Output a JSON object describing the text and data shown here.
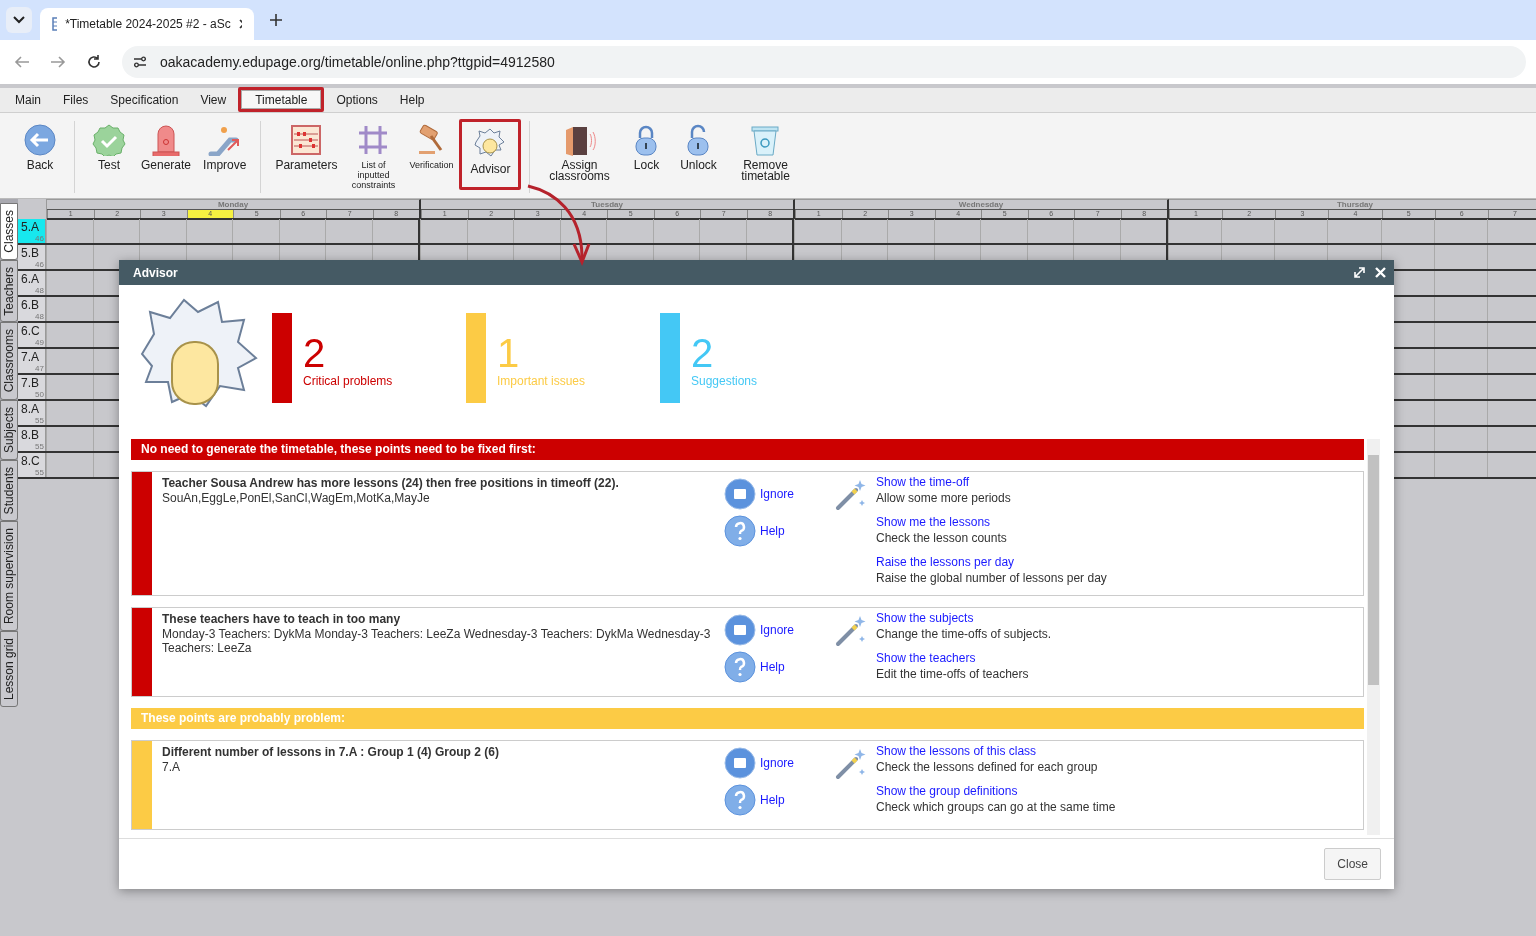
{
  "browser": {
    "tab_title": "*Timetable 2024-2025 #2 - aSc",
    "url": "oakacademy.edupage.org/timetable/online.php?ttgpid=4912580"
  },
  "menu": [
    {
      "label": "Main",
      "selected": false,
      "highlighted": false
    },
    {
      "label": "Files",
      "selected": false,
      "highlighted": false
    },
    {
      "label": "Specification",
      "selected": false,
      "highlighted": false
    },
    {
      "label": "View",
      "selected": false,
      "highlighted": false
    },
    {
      "label": "Timetable",
      "selected": true,
      "highlighted": true
    },
    {
      "label": "Options",
      "selected": false,
      "highlighted": false
    },
    {
      "label": "Help",
      "selected": false,
      "highlighted": false
    }
  ],
  "toolbar_groups": [
    {
      "buttons": [
        {
          "label": "Back",
          "kind": "back",
          "highlighted": false
        }
      ]
    },
    {
      "buttons": [
        {
          "label": "Test",
          "kind": "test",
          "highlighted": false
        },
        {
          "label": "Generate",
          "kind": "generate",
          "highlighted": false
        },
        {
          "label": "Improve",
          "kind": "improve",
          "highlighted": false
        }
      ]
    },
    {
      "buttons": [
        {
          "label": "Parameters",
          "kind": "parameters",
          "highlighted": false
        },
        {
          "label": "List of inputted constraints",
          "kind": "constraints",
          "highlighted": false
        },
        {
          "label": "Verification",
          "kind": "verification",
          "highlighted": false
        },
        {
          "label": "Advisor",
          "kind": "advisor",
          "highlighted": true
        }
      ]
    },
    {
      "buttons": [
        {
          "label": "Assign classrooms",
          "kind": "assign",
          "highlighted": false
        },
        {
          "label": "Lock",
          "kind": "lock",
          "highlighted": false
        },
        {
          "label": "Unlock",
          "kind": "unlock",
          "highlighted": false
        },
        {
          "label": "Remove timetable",
          "kind": "remove",
          "highlighted": false
        }
      ]
    }
  ],
  "side_tabs": [
    {
      "label": "Classes",
      "selected": true
    },
    {
      "label": "Teachers",
      "selected": false
    },
    {
      "label": "Classrooms",
      "selected": false
    },
    {
      "label": "Subjects",
      "selected": false
    },
    {
      "label": "Students",
      "selected": false
    },
    {
      "label": "Room supervision",
      "selected": false
    },
    {
      "label": "Lesson grid",
      "selected": false
    }
  ],
  "timetable": {
    "days": [
      {
        "name": "Monday",
        "periods": [
          {
            "label": "1",
            "selected": false
          },
          {
            "label": "2",
            "selected": false
          },
          {
            "label": "3",
            "selected": false
          },
          {
            "label": "4",
            "selected": true
          },
          {
            "label": "5",
            "selected": false
          },
          {
            "label": "6",
            "selected": false
          },
          {
            "label": "7",
            "selected": false
          },
          {
            "label": "8",
            "selected": false
          }
        ]
      },
      {
        "name": "Tuesday",
        "periods": [
          {
            "label": "1",
            "selected": false
          },
          {
            "label": "2",
            "selected": false
          },
          {
            "label": "3",
            "selected": false
          },
          {
            "label": "4",
            "selected": false
          },
          {
            "label": "5",
            "selected": false
          },
          {
            "label": "6",
            "selected": false
          },
          {
            "label": "7",
            "selected": false
          },
          {
            "label": "8",
            "selected": false
          }
        ]
      },
      {
        "name": "Wednesday",
        "periods": [
          {
            "label": "1",
            "selected": false
          },
          {
            "label": "2",
            "selected": false
          },
          {
            "label": "3",
            "selected": false
          },
          {
            "label": "4",
            "selected": false
          },
          {
            "label": "5",
            "selected": false
          },
          {
            "label": "6",
            "selected": false
          },
          {
            "label": "7",
            "selected": false
          },
          {
            "label": "8",
            "selected": false
          }
        ]
      },
      {
        "name": "Thursday",
        "periods": [
          {
            "label": "1",
            "selected": false
          },
          {
            "label": "2",
            "selected": false
          },
          {
            "label": "3",
            "selected": false
          },
          {
            "label": "4",
            "selected": false
          },
          {
            "label": "5",
            "selected": false
          },
          {
            "label": "6",
            "selected": false
          },
          {
            "label": "7",
            "selected": false
          }
        ]
      }
    ],
    "rows": [
      {
        "name": "5.A",
        "count": "46",
        "selected": true
      },
      {
        "name": "5.B",
        "count": "46",
        "selected": false
      },
      {
        "name": "6.A",
        "count": "48",
        "selected": false
      },
      {
        "name": "6.B",
        "count": "48",
        "selected": false
      },
      {
        "name": "6.C",
        "count": "49",
        "selected": false
      },
      {
        "name": "7.A",
        "count": "47",
        "selected": false
      },
      {
        "name": "7.B",
        "count": "50",
        "selected": false
      },
      {
        "name": "8.A",
        "count": "55",
        "selected": false
      },
      {
        "name": "8.B",
        "count": "55",
        "selected": false
      },
      {
        "name": "8.C",
        "count": "55",
        "selected": false
      }
    ]
  },
  "advisor": {
    "title": "Advisor",
    "stats": [
      {
        "count": "2",
        "label": "Critical problems",
        "color": "#cc0000"
      },
      {
        "count": "1",
        "label": "Important issues",
        "color": "#fccb45"
      },
      {
        "count": "2",
        "label": "Suggestions",
        "color": "#44c8f5"
      }
    ],
    "sections": [
      {
        "heading": "No need to generate the timetable, these points need to be fixed first:",
        "color": "#cc0000",
        "items": [
          {
            "title": "Teacher Sousa Andrew has more lessons (24) then free positions in timeoff (22).",
            "detail": "SouAn,EggLe,PonEl,SanCl,WagEm,MotKa,MayJe",
            "buttons": [
              {
                "kind": "ignore",
                "label": "Ignore"
              },
              {
                "kind": "help",
                "label": "Help"
              }
            ],
            "actions": [
              {
                "link": "Show the time-off",
                "description": "Allow some more periods"
              },
              {
                "link": "Show me the lessons",
                "description": "Check the lesson counts"
              },
              {
                "link": "Raise the lessons per day",
                "description": "Raise the global number of lessons per day"
              }
            ]
          },
          {
            "title": "These teachers have to teach in too many",
            "detail": "Monday-3 Teachers: DykMa Monday-3 Teachers: LeeZa Wednesday-3 Teachers: DykMa Wednesday-3 Teachers: LeeZa",
            "buttons": [
              {
                "kind": "ignore",
                "label": "Ignore"
              },
              {
                "kind": "help",
                "label": "Help"
              }
            ],
            "actions": [
              {
                "link": "Show the subjects",
                "description": "Change the time-offs of subjects."
              },
              {
                "link": "Show the teachers",
                "description": "Edit the time-offs of teachers"
              }
            ]
          }
        ]
      },
      {
        "heading": "These points are probably problem:",
        "color": "#fccb45",
        "items": [
          {
            "title": "Different number of lessons in 7.A : Group 1 (4) Group 2 (6)",
            "detail": "7.A",
            "buttons": [
              {
                "kind": "ignore",
                "label": "Ignore"
              },
              {
                "kind": "help",
                "label": "Help"
              }
            ],
            "actions": [
              {
                "link": "Show the lessons of this class",
                "description": "Check the lessons defined for each group"
              },
              {
                "link": "Show the group definitions",
                "description": "Check which groups can go at the same time"
              }
            ]
          }
        ]
      }
    ],
    "close": "Close"
  }
}
